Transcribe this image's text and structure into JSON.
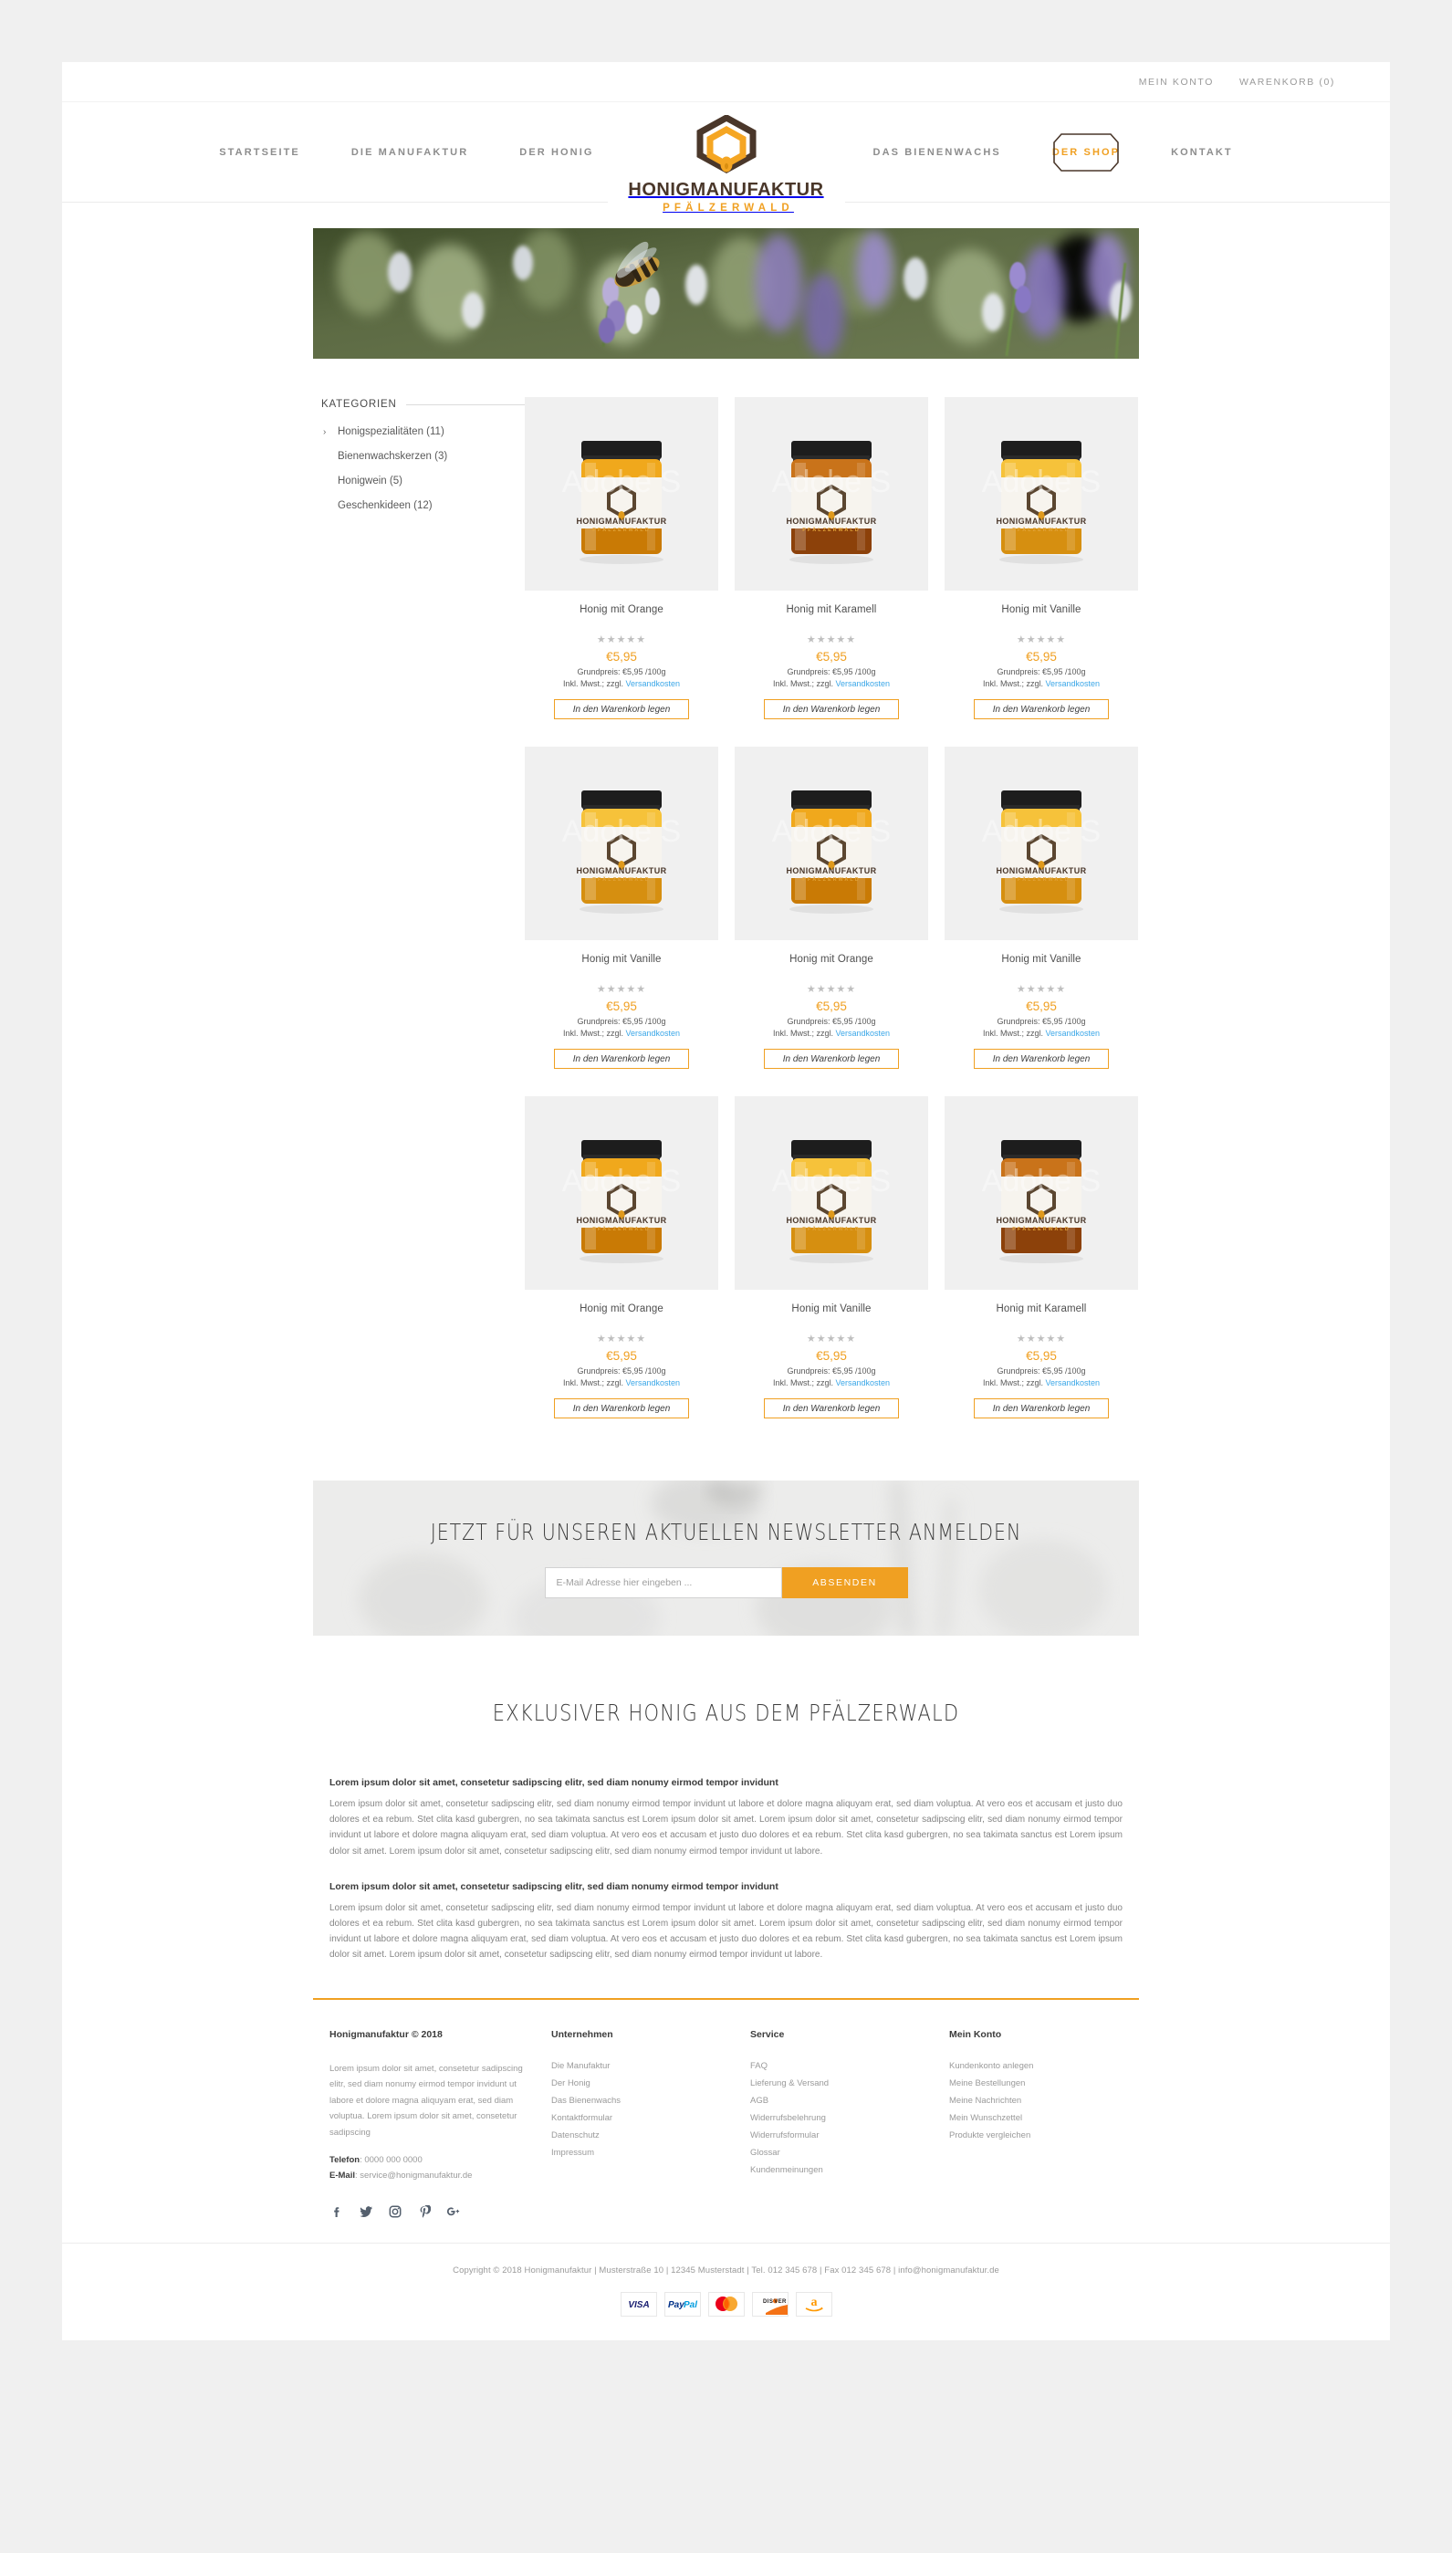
{
  "topbar": {
    "account_label": "MEIN KONTO",
    "cart_label": "WARENKORB (0)"
  },
  "logo": {
    "name": "HONIGMANUFAKTUR",
    "subtitle": "PFÄLZERWALD"
  },
  "nav": {
    "items": [
      {
        "label": "STARTSEITE",
        "active": false
      },
      {
        "label": "DIE MANUFAKTUR",
        "active": false
      },
      {
        "label": "DER HONIG",
        "active": false
      },
      {
        "label": "DAS BIENENWACHS",
        "active": false
      },
      {
        "label": "DER SHOP",
        "active": true
      },
      {
        "label": "KONTAKT",
        "active": false
      }
    ]
  },
  "sidebar": {
    "heading": "KATEGORIEN",
    "items": [
      {
        "label": "Honigspezialitäten (11)",
        "expanded": true
      },
      {
        "label": "Bienenwachskerzen (3)",
        "expanded": false
      },
      {
        "label": "Honigwein (5)",
        "expanded": false
      },
      {
        "label": "Geschenkideen (12)",
        "expanded": false
      }
    ],
    "chevron": "›"
  },
  "products": {
    "stars": "★★★★★",
    "base_price_label": "Grundpreis: €5,95 /100g",
    "tax_prefix": "Inkl. Mwst.; zzgl. ",
    "shipping_link": "Versandkosten",
    "cart_button": "In den Warenkorb legen",
    "items": [
      {
        "title": "Honig mit Orange",
        "price": "€5,95",
        "jar": "amber"
      },
      {
        "title": "Honig mit Karamell",
        "price": "€5,95",
        "jar": "dark"
      },
      {
        "title": "Honig mit Vanille",
        "price": "€5,95",
        "jar": "light"
      },
      {
        "title": "Honig mit Vanille",
        "price": "€5,95",
        "jar": "light"
      },
      {
        "title": "Honig mit Orange",
        "price": "€5,95",
        "jar": "amber"
      },
      {
        "title": "Honig mit Vanille",
        "price": "€5,95",
        "jar": "light"
      },
      {
        "title": "Honig mit Orange",
        "price": "€5,95",
        "jar": "amber"
      },
      {
        "title": "Honig mit Vanille",
        "price": "€5,95",
        "jar": "light"
      },
      {
        "title": "Honig mit Karamell",
        "price": "€5,95",
        "jar": "dark"
      }
    ]
  },
  "newsletter": {
    "title": "JETZT FÜR UNSEREN AKTUELLEN NEWSLETTER ANMELDEN",
    "placeholder": "E-Mail Adresse hier eingeben ...",
    "value": "",
    "submit_label": "ABSENDEN"
  },
  "about": {
    "title": "EXKLUSIVER HONIG AUS DEM PFÄLZERWALD",
    "blocks": [
      {
        "heading": "Lorem ipsum dolor sit amet, consetetur sadipscing elitr, sed diam nonumy eirmod tempor invidunt",
        "body": "Lorem ipsum dolor sit amet, consetetur sadipscing elitr, sed diam nonumy eirmod tempor invidunt ut labore et dolore magna aliquyam erat, sed diam voluptua. At vero eos et accusam et justo duo dolores et ea rebum. Stet clita kasd gubergren, no sea takimata sanctus est Lorem ipsum dolor sit amet. Lorem ipsum dolor sit amet, consetetur sadipscing elitr, sed diam nonumy eirmod tempor invidunt ut labore et dolore magna aliquyam erat, sed diam voluptua. At vero eos et accusam et justo duo dolores et ea rebum. Stet clita kasd gubergren, no sea takimata sanctus est Lorem ipsum dolor sit amet. Lorem ipsum dolor sit amet, consetetur sadipscing elitr, sed diam nonumy eirmod tempor invidunt ut labore."
      },
      {
        "heading": "Lorem ipsum dolor sit amet, consetetur sadipscing elitr, sed diam nonumy eirmod tempor invidunt",
        "body": "Lorem ipsum dolor sit amet, consetetur sadipscing elitr, sed diam nonumy eirmod tempor invidunt ut labore et dolore magna aliquyam erat, sed diam voluptua. At vero eos et accusam et justo duo dolores et ea rebum. Stet clita kasd gubergren, no sea takimata sanctus est Lorem ipsum dolor sit amet. Lorem ipsum dolor sit amet, consetetur sadipscing elitr, sed diam nonumy eirmod tempor invidunt ut labore et dolore magna aliquyam erat, sed diam voluptua. At vero eos et accusam et justo duo dolores et ea rebum. Stet clita kasd gubergren, no sea takimata sanctus est Lorem ipsum dolor sit amet. Lorem ipsum dolor sit amet, consetetur sadipscing elitr, sed diam nonumy eirmod tempor invidunt ut labore."
      }
    ]
  },
  "footer": {
    "col1": {
      "heading": "Honigmanufaktur © 2018",
      "text": "Lorem ipsum dolor sit amet, consetetur sadipscing elitr, sed diam nonumy eirmod tempor invidunt ut labore et dolore magna aliquyam erat, sed diam voluptua. Lorem ipsum dolor sit amet, consetetur sadipscing",
      "phone_label": "Telefon",
      "phone_value": ": 0000 000 0000",
      "email_label": "E-Mail",
      "email_value": ": service@honigmanufaktur.de"
    },
    "col2": {
      "heading": "Unternehmen",
      "links": [
        "Die Manufaktur",
        "Der Honig",
        "Das Bienenwachs",
        "Kontaktformular",
        "Datenschutz",
        "Impressum"
      ]
    },
    "col3": {
      "heading": "Service",
      "links": [
        "FAQ",
        "Lieferung & Versand",
        "AGB",
        "Widerrufsbelehrung",
        "Widerrufsformular",
        "Glossar",
        "Kundenmeinungen"
      ]
    },
    "col4": {
      "heading": "Mein Konto",
      "links": [
        "Kundenkonto anlegen",
        "Meine Bestellungen",
        "Meine Nachrichten",
        "Mein Wunschzettel",
        "Produkte vergleichen"
      ]
    },
    "socials": [
      {
        "icon": "facebook-icon",
        "glyph": "f"
      },
      {
        "icon": "twitter-icon",
        "glyph": "🐦"
      },
      {
        "icon": "instagram-icon",
        "glyph": "◻"
      },
      {
        "icon": "pinterest-icon",
        "glyph": "P"
      },
      {
        "icon": "google-plus-icon",
        "glyph": "G+"
      }
    ],
    "copyright": "Copyright © 2018 Honigmanufaktur | Musterstraße 10 | 12345 Musterstadt | Tel. 012 345 678 | Fax 012 345 678 | info@honigmanufaktur.de",
    "payments": [
      "VISA",
      "PayPal",
      "Mastercard",
      "DISCOVER",
      "amazon"
    ]
  },
  "colors": {
    "accent": "#f0a022",
    "link": "#3ba7e8",
    "logo_brown": "#4a372a",
    "text": "#3c3c3c",
    "muted": "#9a9a9a"
  }
}
